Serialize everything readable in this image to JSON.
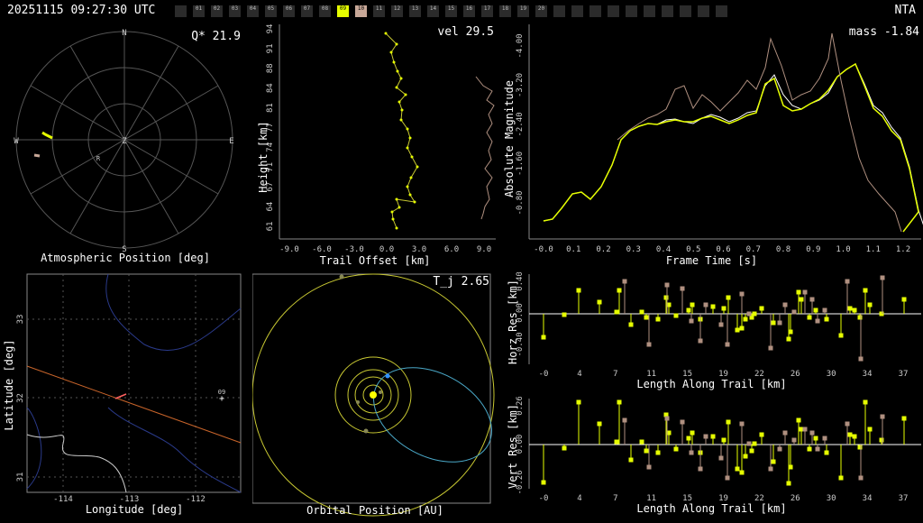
{
  "header": {
    "timestamp": "20251115 09:27:30 UTC",
    "station": "NTA",
    "frames": [
      "01",
      "02",
      "03",
      "04",
      "05",
      "06",
      "07",
      "08",
      "09",
      "10",
      "11",
      "12",
      "13",
      "14",
      "15",
      "16",
      "17",
      "18",
      "19",
      "20"
    ],
    "active_frames": [
      "09",
      "10"
    ]
  },
  "atmospheric": {
    "q_label": "Q* 21.9",
    "caption": "Atmospheric Position [deg]",
    "compass": {
      "n": "N",
      "s": "S",
      "e": "E",
      "w": "W",
      "z": "Z",
      "r": "R"
    }
  },
  "trail": {
    "vel_label": "vel 29.5",
    "ylabel": "Height [km]",
    "xlabel": "Trail Offset [km]",
    "yticks": [
      "94",
      "91",
      "88",
      "84",
      "81",
      "77",
      "74",
      "71",
      "67",
      "64",
      "61"
    ],
    "xticks": [
      "-9.0",
      "-6.0",
      "-3.0",
      "0.0",
      "3.0",
      "6.0",
      "9.0"
    ]
  },
  "magnitude": {
    "mass_label": "mass -1.84",
    "ylabel": "Absolute Magnitude",
    "xlabel": "Frame Time [s]",
    "yticks": [
      "-4.00",
      "-3.20",
      "-2.40",
      "-1.60",
      "-0.80"
    ],
    "xticks": [
      "-0.0",
      "0.1",
      "0.2",
      "0.3",
      "0.4",
      "0.5",
      "0.6",
      "0.7",
      "0.8",
      "0.9",
      "1.0",
      "1.1",
      "1.2"
    ]
  },
  "ground": {
    "ylabel": "Latitude [deg]",
    "xlabel": "Longitude [deg]",
    "yticks": [
      "33",
      "32",
      "31"
    ],
    "xticks": [
      "-114",
      "-113",
      "-112"
    ],
    "marker_label": "09"
  },
  "orbit": {
    "tj_label": "T_j 2.65",
    "caption": "Orbital Position [AU]"
  },
  "horz_res": {
    "ylabel": "Horz Res [km]",
    "xlabel": "Length Along Trail [km]",
    "yticks": [
      "0.40",
      "0.00",
      "-0.40"
    ],
    "xticks": [
      "-0",
      "4",
      "7",
      "11",
      "15",
      "19",
      "22",
      "26",
      "30",
      "34",
      "37"
    ]
  },
  "vert_res": {
    "ylabel": "Vert Res [km]",
    "xlabel": "Length Along Trail [km]",
    "yticks": [
      "0.26",
      "0.00",
      "-0.26"
    ],
    "xticks": [
      "-0",
      "4",
      "7",
      "11",
      "15",
      "19",
      "22",
      "26",
      "30",
      "34",
      "37"
    ]
  },
  "colors": {
    "primary": "#e6ff00",
    "secondary": "#b09080",
    "grid": "#555555",
    "orbit_yellow": "#c8c832",
    "orbit_blue": "#4aa8c8"
  }
}
